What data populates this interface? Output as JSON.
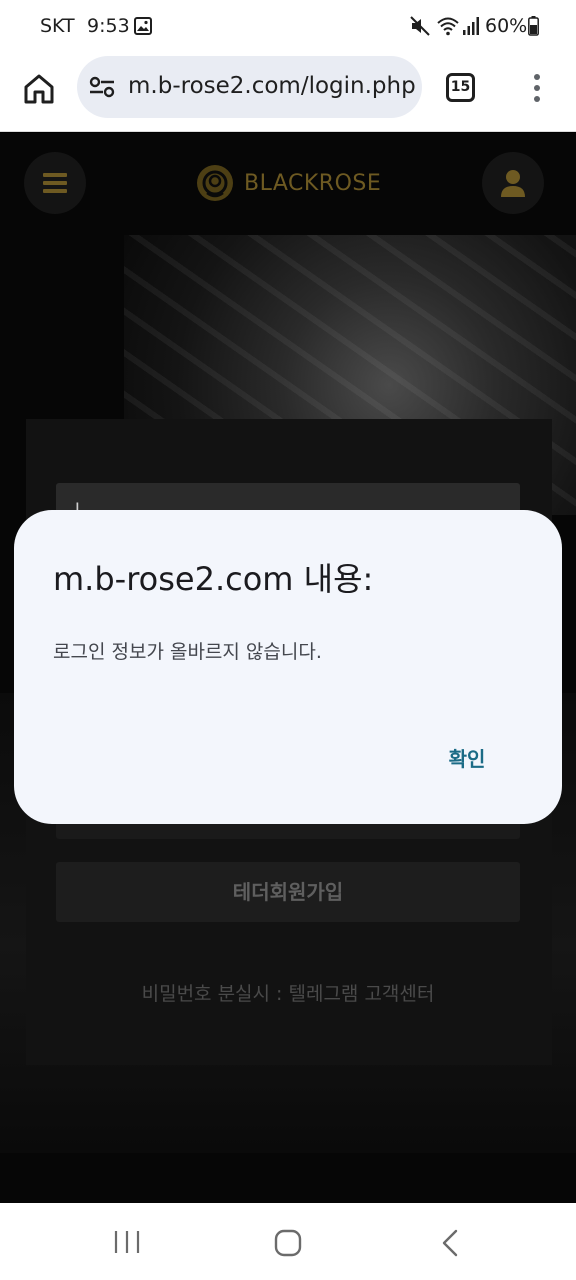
{
  "status_bar": {
    "carrier": "SKT",
    "time": "9:53",
    "battery": "60%",
    "icons": [
      "gallery-icon",
      "mute-icon",
      "wifi-icon",
      "signal-icon",
      "battery-icon"
    ]
  },
  "browser": {
    "url": "m.b-rose2.com/login.php",
    "tab_count": "15",
    "icons": [
      "home-icon",
      "tune-icon",
      "menu-icon"
    ]
  },
  "site": {
    "brand_name": "BLACKROSE",
    "id_field_value": "|",
    "signup_button": "테더회원가입",
    "help_text": "비밀번호 분실시 : 텔레그램 고객센터",
    "brand_color": "#c9a227"
  },
  "dialog": {
    "title": "m.b-rose2.com 내용:",
    "message": "로그인 정보가 올바르지 않습니다.",
    "ok_label": "확인",
    "accent_color": "#1b6b86"
  },
  "nav_bar": {
    "icons": [
      "recents-icon",
      "home-nav-icon",
      "back-icon"
    ]
  }
}
